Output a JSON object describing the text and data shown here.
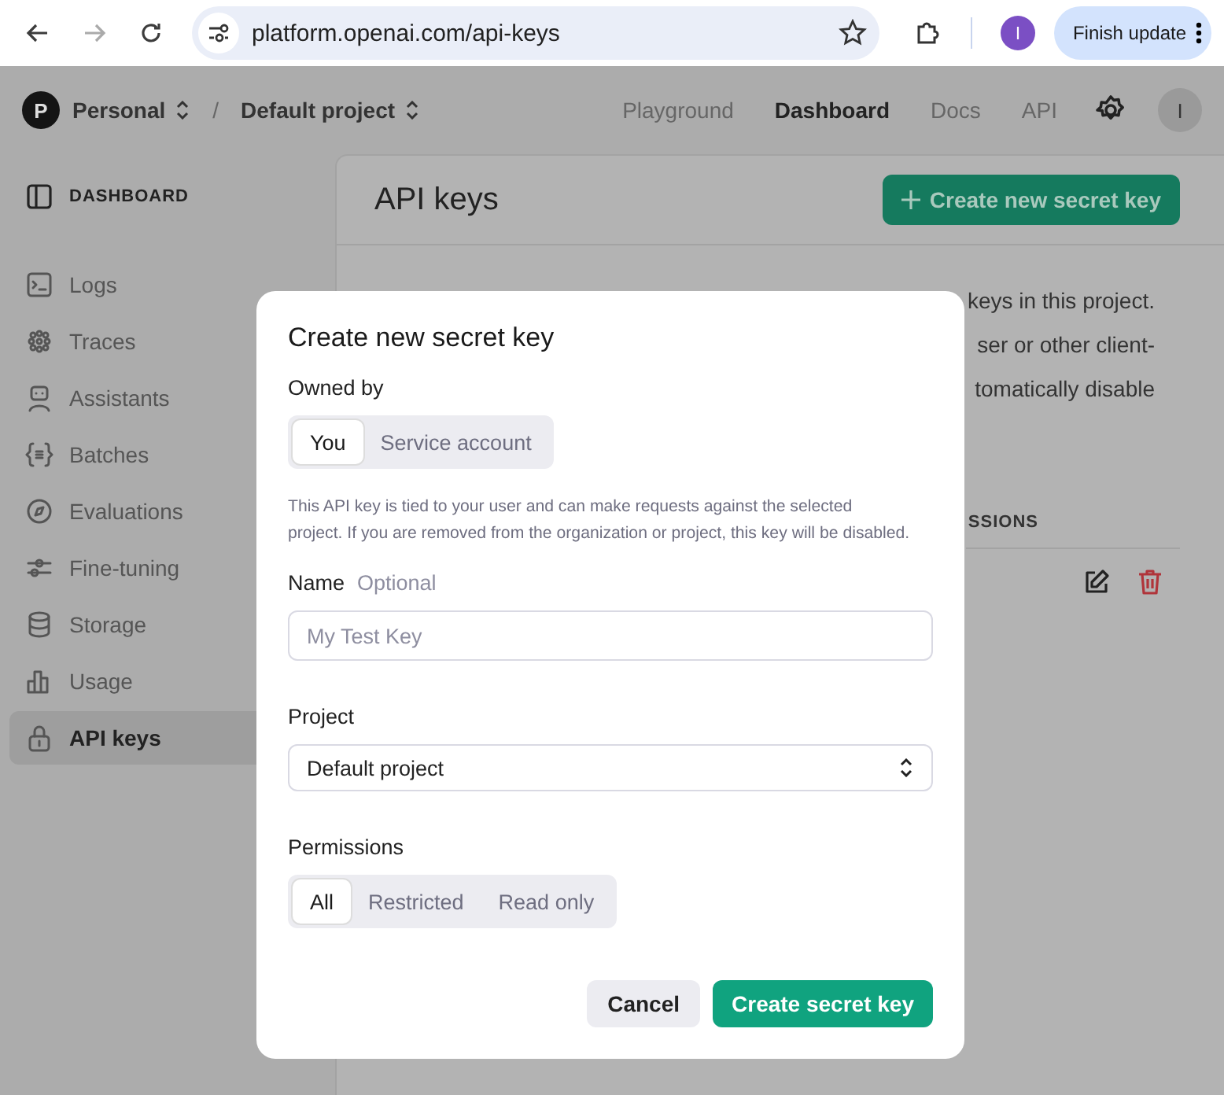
{
  "browser": {
    "url": "platform.openai.com/api-keys",
    "profile_initial": "I",
    "update_button": "Finish update"
  },
  "header": {
    "org_initial": "P",
    "org": "Personal",
    "separator": "/",
    "project": "Default project",
    "nav": [
      {
        "label": "Playground",
        "selected": false
      },
      {
        "label": "Dashboard",
        "selected": true
      },
      {
        "label": "Docs",
        "selected": false
      },
      {
        "label": "API",
        "selected": false
      }
    ],
    "avatar": "I"
  },
  "sidebar": {
    "section": "DASHBOARD",
    "items": [
      {
        "label": "Logs",
        "selected": false
      },
      {
        "label": "Traces",
        "selected": false
      },
      {
        "label": "Assistants",
        "selected": false
      },
      {
        "label": "Batches",
        "selected": false
      },
      {
        "label": "Evaluations",
        "selected": false
      },
      {
        "label": "Fine-tuning",
        "selected": false
      },
      {
        "label": "Storage",
        "selected": false
      },
      {
        "label": "Usage",
        "selected": false
      },
      {
        "label": "API keys",
        "selected": true
      }
    ]
  },
  "main": {
    "title": "API keys",
    "create_button": "Create new secret key",
    "visible_text": [
      "keys in this project.",
      "ser or other client-",
      "tomatically disable"
    ],
    "column_header": "SSIONS"
  },
  "modal": {
    "title": "Create new secret key",
    "owned_by_label": "Owned by",
    "owners": [
      {
        "label": "You",
        "selected": true
      },
      {
        "label": "Service account",
        "selected": false
      }
    ],
    "note": "This API key is tied to your user and can make requests against the selected project. If you are removed from the organization or project, this key will be disabled.",
    "name_label": "Name",
    "name_hint": "Optional",
    "name_field": {
      "placeholder": "My Test Key"
    },
    "project_label": "Project",
    "project_value": "Default project",
    "permissions_label": "Permissions",
    "permissions": [
      {
        "label": "All",
        "selected": true
      },
      {
        "label": "Restricted",
        "selected": false
      },
      {
        "label": "Read only",
        "selected": false
      }
    ],
    "cancel_button": "Cancel",
    "submit_button": "Create secret key"
  }
}
